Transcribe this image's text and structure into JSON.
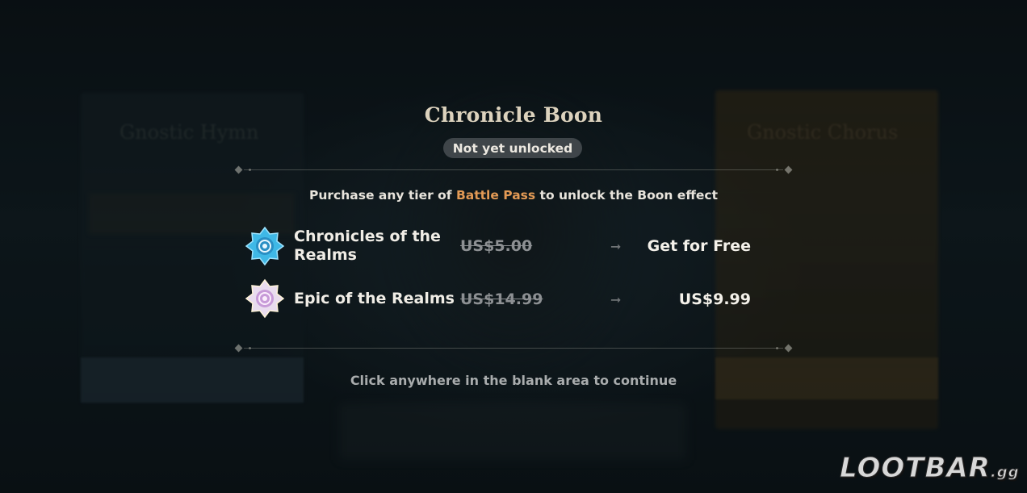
{
  "dialog": {
    "title": "Chronicle Boon",
    "status": "Not yet unlocked",
    "purchase_prefix": "Purchase any tier of",
    "purchase_highlight": "Battle Pass",
    "purchase_suffix": "to unlock the Boon effect",
    "rows": [
      {
        "name_line1": "Chronicles of the",
        "name_line2": "Realms",
        "old_price": "US$5.00",
        "new_price": "Get for Free",
        "icon": "blue-star-badge-icon",
        "icon_color": "#3fb8e6"
      },
      {
        "name": "Epic of the Realms",
        "old_price": "US$14.99",
        "new_price": "US$9.99",
        "icon": "pink-star-badge-icon",
        "icon_color": "#d8b8e6"
      }
    ],
    "continue_hint": "Click anywhere in the blank area to continue"
  },
  "background": {
    "left_panel_title": "Gnostic Hymn",
    "right_panel_title": "Gnostic Chorus"
  },
  "watermark": {
    "brand": "LOOTBAR",
    "suffix": ".gg"
  },
  "colors": {
    "highlight": "#e39a55",
    "title": "#dcd2bd",
    "strikethrough": "#8d9093"
  }
}
